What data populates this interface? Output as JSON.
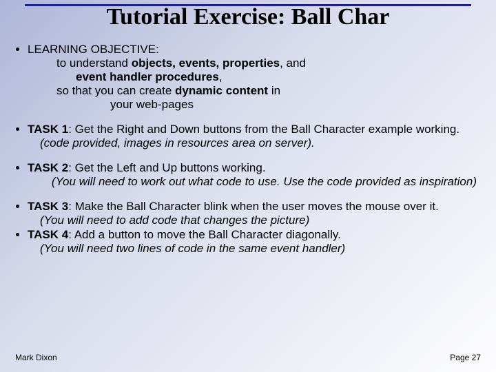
{
  "title": "Tutorial Exercise: Ball Char",
  "objective": {
    "label": "LEARNING OBJECTIVE:",
    "l2a": "to understand ",
    "l2b": "objects, events, properties",
    "l2c": ", and",
    "l3": "event handler procedures",
    "l3tail": ",",
    "l4a": "so that you can create ",
    "l4b": "dynamic content",
    "l4c": " in",
    "l5": "your web-pages"
  },
  "task1": {
    "label": "TASK 1",
    "text": ": Get the Right and Down buttons from the Ball Character example working.",
    "sub": "(code provided, images in resources area on server)."
  },
  "task2": {
    "label": "TASK 2",
    "text": ": Get the Left and Up buttons working.",
    "sub": "(You will need to work out what code to use. Use the code provided as inspiration)"
  },
  "task3": {
    "label": "TASK 3",
    "text": ": Make the Ball Character blink when the user moves the mouse over it.",
    "sub": "(You will need to add code that changes the picture)"
  },
  "task4": {
    "label": "TASK 4",
    "text": ": Add a button to move the Ball Character diagonally.",
    "sub": "(You will need two lines of code in the same event handler)"
  },
  "footer": {
    "author": "Mark Dixon",
    "page": "Page 27"
  }
}
